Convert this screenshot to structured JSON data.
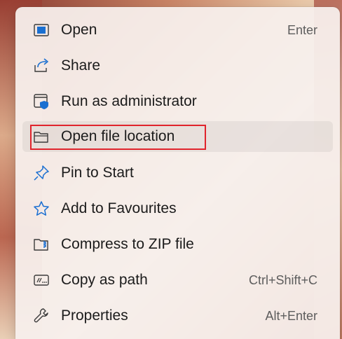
{
  "menu": {
    "items": [
      {
        "label": "Open",
        "shortcut": "Enter",
        "icon": "open-window-icon"
      },
      {
        "label": "Share",
        "shortcut": "",
        "icon": "share-icon"
      },
      {
        "label": "Run as administrator",
        "shortcut": "",
        "icon": "shield-window-icon"
      },
      {
        "label": "Open file location",
        "shortcut": "",
        "icon": "folder-icon"
      },
      {
        "label": "Pin to Start",
        "shortcut": "",
        "icon": "pin-icon"
      },
      {
        "label": "Add to Favourites",
        "shortcut": "",
        "icon": "star-icon"
      },
      {
        "label": "Compress to ZIP file",
        "shortcut": "",
        "icon": "zip-folder-icon"
      },
      {
        "label": "Copy as path",
        "shortcut": "Ctrl+Shift+C",
        "icon": "copy-path-icon"
      },
      {
        "label": "Properties",
        "shortcut": "Alt+Enter",
        "icon": "wrench-icon"
      }
    ],
    "highlighted_index": 3
  },
  "colors": {
    "accent": "#1a6fd1",
    "highlight_border": "#e0242c",
    "text": "#1b1b1b",
    "shortcut_text": "#5d5d5d"
  }
}
